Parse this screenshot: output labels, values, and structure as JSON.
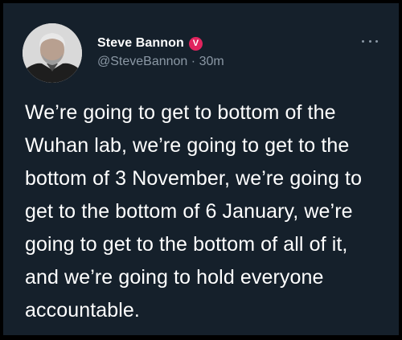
{
  "author": {
    "display_name": "Steve Bannon",
    "badge_letter": "V",
    "handle": "@SteveBannon",
    "separator": "·",
    "time": "30m",
    "avatar_icon": "profile-photo"
  },
  "tweet": {
    "text": "We’re going to get to bottom of the Wuhan lab, we’re going to get to the bottom of 3 November, we’re going to get to the bottom of 6 January, we’re going to get to the bottom of all of it, and we’re going to hold everyone accountable."
  },
  "menu": {
    "icon": "more-horizontal-icon"
  },
  "colors": {
    "page_background": "#000000",
    "card_background": "#15202b",
    "primary_text": "#ffffff",
    "secondary_text": "#8b98a5",
    "badge": "#e0245e"
  }
}
